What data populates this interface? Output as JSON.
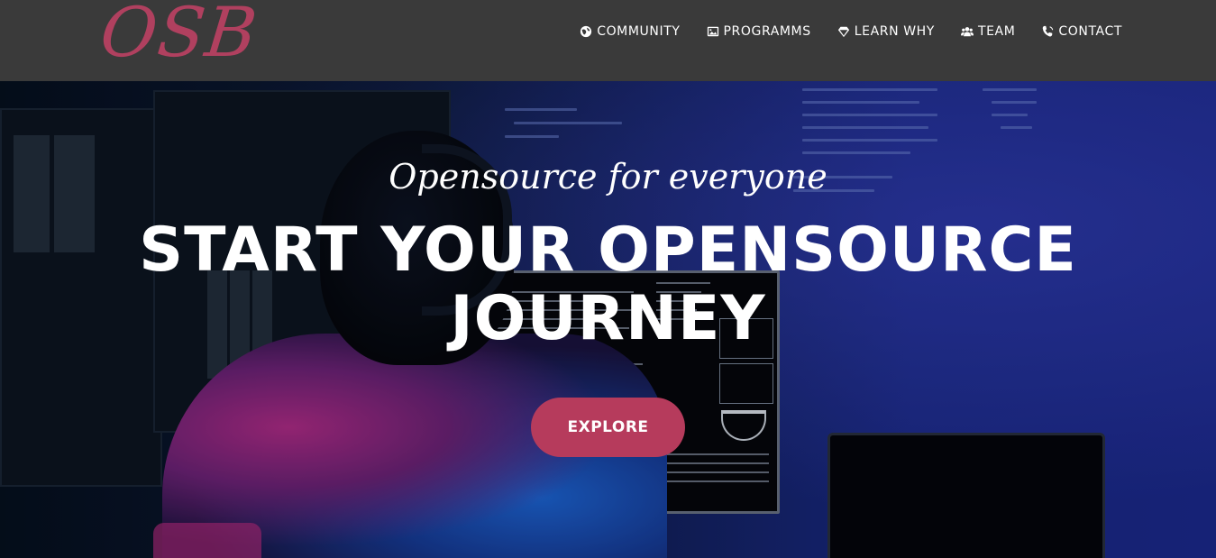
{
  "brand": {
    "logo_text": "OSB",
    "logo_color": "#b0405f"
  },
  "nav": {
    "items": [
      {
        "label": "COMMUNITY",
        "icon": "globe-icon"
      },
      {
        "label": "PROGRAMMS",
        "icon": "image-icon"
      },
      {
        "label": "LEARN WHY",
        "icon": "diamond-icon"
      },
      {
        "label": "TEAM",
        "icon": "users-icon"
      },
      {
        "label": "CONTACT",
        "icon": "phone-icon"
      }
    ]
  },
  "hero": {
    "tagline": "Opensource for everyone",
    "headline": "START YOUR OPENSOURCE JOURNEY",
    "cta_label": "EXPLORE",
    "cta_color": "#b63b5c"
  }
}
